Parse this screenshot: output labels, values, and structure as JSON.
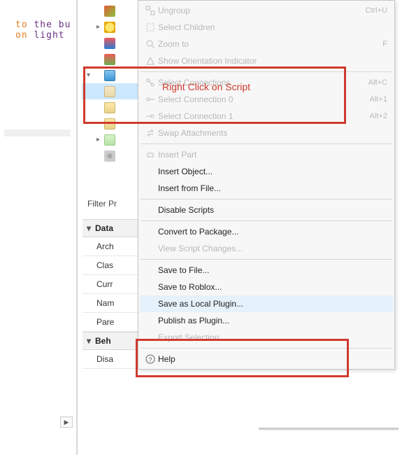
{
  "code": {
    "line1a": "to ",
    "line1b": "the bu",
    "line2a": "on ",
    "line2b": "light "
  },
  "annotation": "Right Click on Script",
  "filter_label": "Filter Pr",
  "properties": {
    "sec1": "Data",
    "rows1": [
      "Arch",
      "Clas",
      "Curr",
      "Nam",
      "Pare"
    ],
    "sec2": "Beh",
    "rows2": [
      "Disa"
    ]
  },
  "menu": {
    "ungroup": {
      "label": "Ungroup",
      "shortcut": "Ctrl+U"
    },
    "select_children": {
      "label": "Select Children",
      "shortcut": ""
    },
    "zoom_to": {
      "label": "Zoom to",
      "shortcut": "F"
    },
    "show_orient": {
      "label": "Show Orientation Indicator",
      "shortcut": ""
    },
    "sel_conns": {
      "label": "Select Connections",
      "shortcut": "Alt+C"
    },
    "sel_conn0": {
      "label": "Select Connection 0",
      "shortcut": "Alt+1"
    },
    "sel_conn1": {
      "label": "Select Connection 1",
      "shortcut": "Alt+2"
    },
    "swap_attach": {
      "label": "Swap Attachments",
      "shortcut": ""
    },
    "insert_part": {
      "label": "Insert Part",
      "shortcut": ""
    },
    "insert_obj": {
      "label": "Insert Object...",
      "shortcut": ""
    },
    "insert_file": {
      "label": "Insert from File...",
      "shortcut": ""
    },
    "disable_scripts": {
      "label": "Disable Scripts",
      "shortcut": ""
    },
    "convert_pkg": {
      "label": "Convert to Package...",
      "shortcut": ""
    },
    "view_script": {
      "label": "View Script Changes...",
      "shortcut": ""
    },
    "save_file": {
      "label": "Save to File...",
      "shortcut": ""
    },
    "save_roblox": {
      "label": "Save to Roblox...",
      "shortcut": ""
    },
    "save_local": {
      "label": "Save as Local Plugin...",
      "shortcut": ""
    },
    "publish_plugin": {
      "label": "Publish as Plugin...",
      "shortcut": ""
    },
    "export_sel": {
      "label": "Export Selection...",
      "shortcut": ""
    },
    "help": {
      "label": "Help",
      "shortcut": ""
    }
  }
}
